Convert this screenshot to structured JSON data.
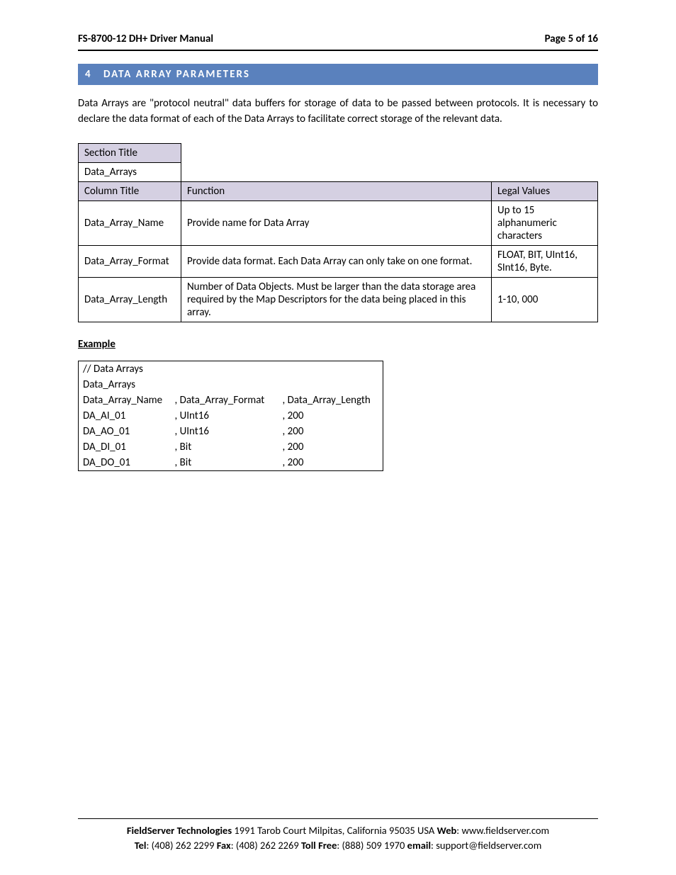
{
  "header": {
    "title": "FS-8700-12 DH+ Driver Manual",
    "page": "Page 5 of 16"
  },
  "section": {
    "number": "4",
    "title": "DATA ARRAY PARAMETERS"
  },
  "intro": "Data Arrays are \"protocol neutral\" data buffers for storage of data to be passed between protocols.  It is necessary to declare the data format of each of the Data Arrays to facilitate correct storage of the relevant data.",
  "table": {
    "section_title_label": "Section Title",
    "section_title_value": "Data_Arrays",
    "column_title_label": "Column Title",
    "function_label": "Function",
    "legal_label": "Legal Values",
    "rows": [
      {
        "name": "Data_Array_Name",
        "function": "Provide name for Data Array",
        "legal": "Up to 15 alphanumeric characters"
      },
      {
        "name": "Data_Array_Format",
        "function": "Provide data format. Each Data Array can only take on one format.",
        "legal": "FLOAT, BIT, UInt16, SInt16, Byte."
      },
      {
        "name": "Data_Array_Length",
        "function": "Number of Data Objects. Must be larger than the data storage area required by the Map Descriptors for the data being placed in this array.",
        "legal": "1-10, 000"
      }
    ]
  },
  "example": {
    "label": "Example",
    "rows": [
      [
        "//    Data Arrays",
        "",
        ""
      ],
      [
        "Data_Arrays",
        "",
        ""
      ],
      [
        "Data_Array_Name",
        ", Data_Array_Format",
        ", Data_Array_Length"
      ],
      [
        "DA_AI_01",
        ", UInt16",
        ", 200"
      ],
      [
        "DA_AO_01",
        ", UInt16",
        ", 200"
      ],
      [
        "DA_DI_01",
        ", Bit",
        ", 200"
      ],
      [
        "DA_DO_01",
        ", Bit",
        ", 200"
      ]
    ]
  },
  "footer": {
    "company": "FieldServer Technologies",
    "address": " 1991 Tarob Court Milpitas, California 95035 USA   ",
    "web_label": "Web",
    "web": ": www.fieldserver.com",
    "tel_label": "Tel",
    "tel": ": (408) 262 2299   ",
    "fax_label": "Fax",
    "fax": ": (408) 262 2269   ",
    "tollfree_label": "Toll Free",
    "tollfree": ": (888) 509 1970   ",
    "email_label": "email",
    "email": ": support@fieldserver.com"
  }
}
